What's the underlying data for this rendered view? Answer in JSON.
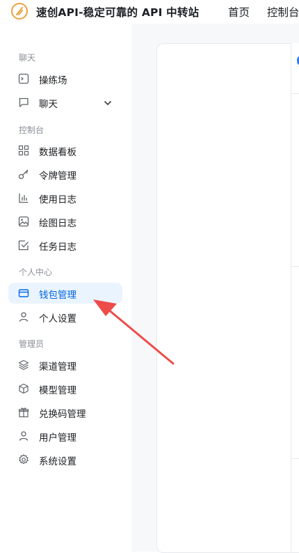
{
  "header": {
    "brand": "速创API-稳定可靠的 API 中转站",
    "nav": [
      "首页",
      "控制台"
    ]
  },
  "sidebar": {
    "sections": [
      {
        "title": "聊天",
        "items": [
          {
            "label": "操练场",
            "icon": "terminal-icon"
          },
          {
            "label": "聊天",
            "icon": "chat-bubble-icon",
            "expandable": true
          }
        ]
      },
      {
        "title": "控制台",
        "items": [
          {
            "label": "数据看板",
            "icon": "grid-icon"
          },
          {
            "label": "令牌管理",
            "icon": "key-icon"
          },
          {
            "label": "使用日志",
            "icon": "bar-chart-icon"
          },
          {
            "label": "绘图日志",
            "icon": "image-icon"
          },
          {
            "label": "任务日志",
            "icon": "checkbox-icon"
          }
        ]
      },
      {
        "title": "个人中心",
        "items": [
          {
            "label": "钱包管理",
            "icon": "wallet-card-icon",
            "active": true
          },
          {
            "label": "个人设置",
            "icon": "user-icon"
          }
        ]
      },
      {
        "title": "管理员",
        "items": [
          {
            "label": "渠道管理",
            "icon": "layers-icon"
          },
          {
            "label": "模型管理",
            "icon": "cube-icon"
          },
          {
            "label": "兑换码管理",
            "icon": "gift-icon"
          },
          {
            "label": "用户管理",
            "icon": "user-icon"
          },
          {
            "label": "系统设置",
            "icon": "gear-icon"
          }
        ]
      }
    ]
  },
  "colors": {
    "accent": "#0064e0",
    "active_bg": "#eaf4ff",
    "annotation_arrow": "#ee4b4b",
    "logo": "#e9a23b"
  }
}
